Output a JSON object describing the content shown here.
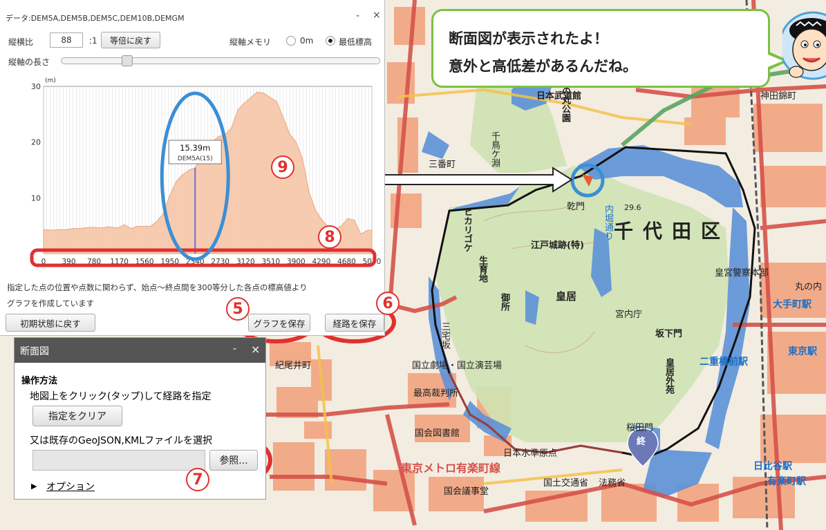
{
  "profile_panel": {
    "title": "データ:DEM5A,DEM5B,DEM5C,DEM10B,DEMGM",
    "minimize": "-",
    "close": "×",
    "ratio_label": "縦横比",
    "ratio_value": "88",
    "ratio_suffix": ":1",
    "reset_ratio_button": "等倍に戻す",
    "axis_memory_label": "縦軸メモリ",
    "axis_option_zero": "0m",
    "axis_option_min": "最低標高",
    "axis_length_label": "縦軸の長さ",
    "axis_length_position": 0.22,
    "note_line1": "指定した点の位置や点数に関わらず、始点～終点間を300等分した各点の標高値より",
    "note_line2": "グラフを作成しています",
    "reset_button": "初期状態に戻す",
    "save_graph_button": "グラフを保存",
    "save_route_button": "経路を保存"
  },
  "chart_data": {
    "type": "area",
    "unit_label": "(m)",
    "x_ticks": [
      0,
      390,
      780,
      1170,
      1560,
      1950,
      2340,
      2730,
      3120,
      3510,
      3900,
      4290,
      4680,
      5070
    ],
    "x_tick_labels": [
      "0",
      "390",
      "780",
      "1170",
      "1560",
      "1950",
      "2340",
      "2730",
      "3120",
      "3510",
      "3900",
      "4290",
      "4680",
      "5070"
    ],
    "y_ticks": [
      10,
      20,
      30
    ],
    "ylim": [
      0,
      30
    ],
    "xlim": [
      0,
      5070
    ],
    "x": [
      0,
      120,
      250,
      350,
      450,
      550,
      700,
      800,
      900,
      1000,
      1150,
      1250,
      1350,
      1450,
      1550,
      1650,
      1750,
      1850,
      1950,
      2050,
      2150,
      2250,
      2340,
      2420,
      2500,
      2600,
      2700,
      2800,
      2900,
      3000,
      3100,
      3200,
      3300,
      3400,
      3500,
      3600,
      3700,
      3800,
      3900,
      4000,
      4100,
      4200,
      4300,
      4400,
      4500,
      4600,
      4700,
      4800,
      4900,
      5000,
      5070
    ],
    "y": [
      4.3,
      4.2,
      4.3,
      4.3,
      4.5,
      4.5,
      4.7,
      4.7,
      4.6,
      4.8,
      4.6,
      5.2,
      4.5,
      4.9,
      4.9,
      4.9,
      5.8,
      7.2,
      10.5,
      13.0,
      14.2,
      15.0,
      15.4,
      17.0,
      19.5,
      20.0,
      21.0,
      21.3,
      22.5,
      25.8,
      27.0,
      28.0,
      29.0,
      28.8,
      28.0,
      27.3,
      24.5,
      21.5,
      20.0,
      17.0,
      11.0,
      7.8,
      6.0,
      4.7,
      4.3,
      5.0,
      6.3,
      6.0,
      3.5,
      4.2,
      4.2
    ],
    "marker": {
      "x": 2340,
      "value_label": "15.39m",
      "source_label": "DEM5A(15)"
    },
    "legend": "none",
    "grid": "vertical lines"
  },
  "route_panel": {
    "title": "断面図",
    "minimize": "-",
    "close": "×",
    "section_title": "操作方法",
    "instruction": "地図上をクリック(タップ)して経路を指定",
    "clear_button": "指定をクリア",
    "file_label": "又は既存のGeoJSON,KMLファイルを選択",
    "browse_button": "参照...",
    "options_link": "オプション",
    "options_arrow": "▶"
  },
  "bubble": {
    "line1": "断面図が表示されたよ！",
    "line2": "意外と高低差があるんだね。"
  },
  "annotations": {
    "n5": "5",
    "n6": "6",
    "n7": "7",
    "n8": "8",
    "n9": "9",
    "color": "#e0312f",
    "highlight": "#3b8fd4"
  },
  "map": {
    "ward": "千代田区",
    "labels": [
      "日本武道館",
      "北の丸公園",
      "乾門",
      "江戸城跡(特)",
      "皇居",
      "宮内庁",
      "坂下門",
      "桜田門",
      "皇居外苑",
      "国立劇場・国立演芸場",
      "最高裁判所",
      "国会図書館",
      "日本水準原点",
      "国会議事堂",
      "三番町",
      "紀尾井町",
      "神田錦町",
      "皇宮警察本部",
      "二重橋前駅",
      "大手町駅",
      "東京駅",
      "丸の内",
      "日比谷駅",
      "有楽町駅",
      "東京メトロ有楽町線",
      "国土交通省",
      "法務省",
      "三宅坂",
      "生育地",
      "ヒカリゴケ",
      "御所",
      "千鳥ケ淵",
      "内堀通り"
    ],
    "end_marker": "終",
    "elevation_note": "29.6",
    "colors": {
      "water": "#5b8fd6",
      "route": "#111111",
      "buildings": "#f4a77a",
      "parks": "#bcd9a4",
      "roads": "#d5524a"
    }
  }
}
